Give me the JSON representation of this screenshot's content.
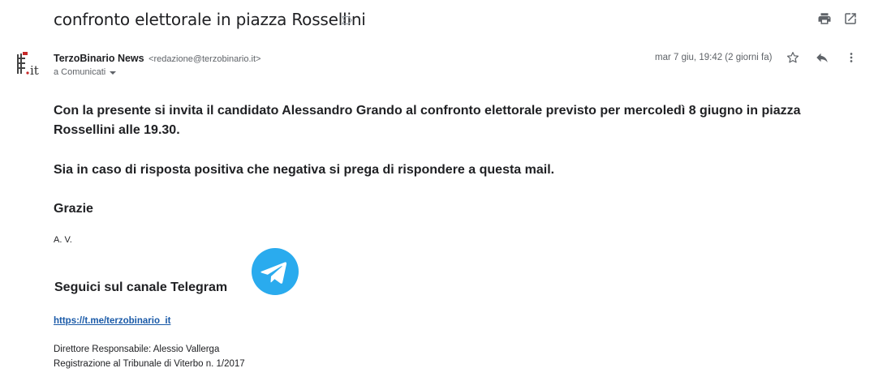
{
  "email": {
    "subject": "confronto elettorale in piazza Rossellini",
    "sender_name": "TerzoBinario News",
    "sender_email": "<redazione@terzobinario.it>",
    "recipient": "a Comunicati",
    "date": "mar 7 giu, 19:42 (2 giorni fa)",
    "avatar_text": "it"
  },
  "body": {
    "p1": "Con la presente si invita il candidato Alessandro Grando al confronto elettorale previsto per mercoledì 8 giugno in piazza Rossellini alle 19.30.",
    "p2": "Sia in caso di risposta positiva che negativa si prega di rispondere a questa mail.",
    "p3": "Grazie",
    "initials": "A. V.",
    "telegram_title": "Seguici sul canale Telegram",
    "telegram_link": "https://t.me/terzobinario_it",
    "footer_1": "Direttore Responsabile: Alessio Vallerga",
    "footer_2": "Registrazione al Tribunale di Viterbo n. 1/2017"
  },
  "icons": {
    "label": "label-outline-icon",
    "print": "print-icon",
    "open_new_window": "open-in-new-window-icon",
    "star": "star-icon",
    "reply": "reply-icon",
    "more": "more-vert-icon",
    "telegram": "telegram-icon"
  },
  "colors": {
    "link": "#1a5aa8",
    "telegram": "#2AABEE",
    "icon_gray": "#5f6368"
  }
}
